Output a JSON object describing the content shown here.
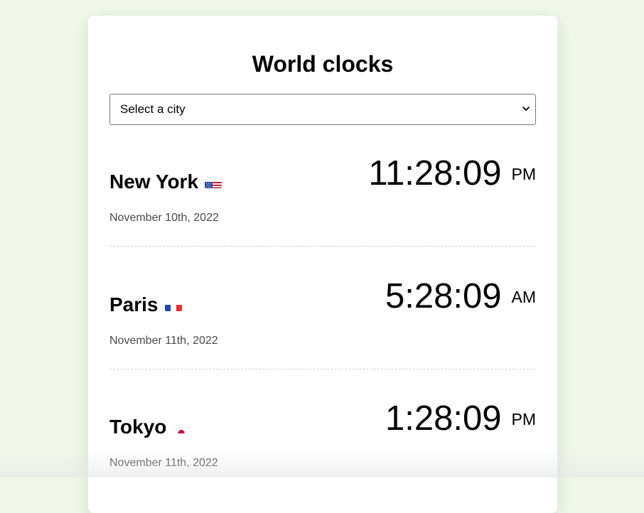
{
  "page": {
    "title": "World clocks"
  },
  "city_select": {
    "selected": "Select a city"
  },
  "cities": [
    {
      "name": "New York",
      "flag": "flag-united-states-icon",
      "date": "November 10th, 2022",
      "time": "11:28:09",
      "ampm": "PM"
    },
    {
      "name": "Paris",
      "flag": "flag-france-icon",
      "date": "November 11th, 2022",
      "time": "5:28:09",
      "ampm": "AM"
    },
    {
      "name": "Tokyo",
      "flag": "flag-japan-icon",
      "date": "November 11th, 2022",
      "time": "1:28:09",
      "ampm": "PM"
    }
  ],
  "colors": {
    "page_background": "#f1f8ea",
    "card_background": "#ffffff",
    "date_text": "#4a4a4a",
    "divider": "#d0d0d0"
  }
}
